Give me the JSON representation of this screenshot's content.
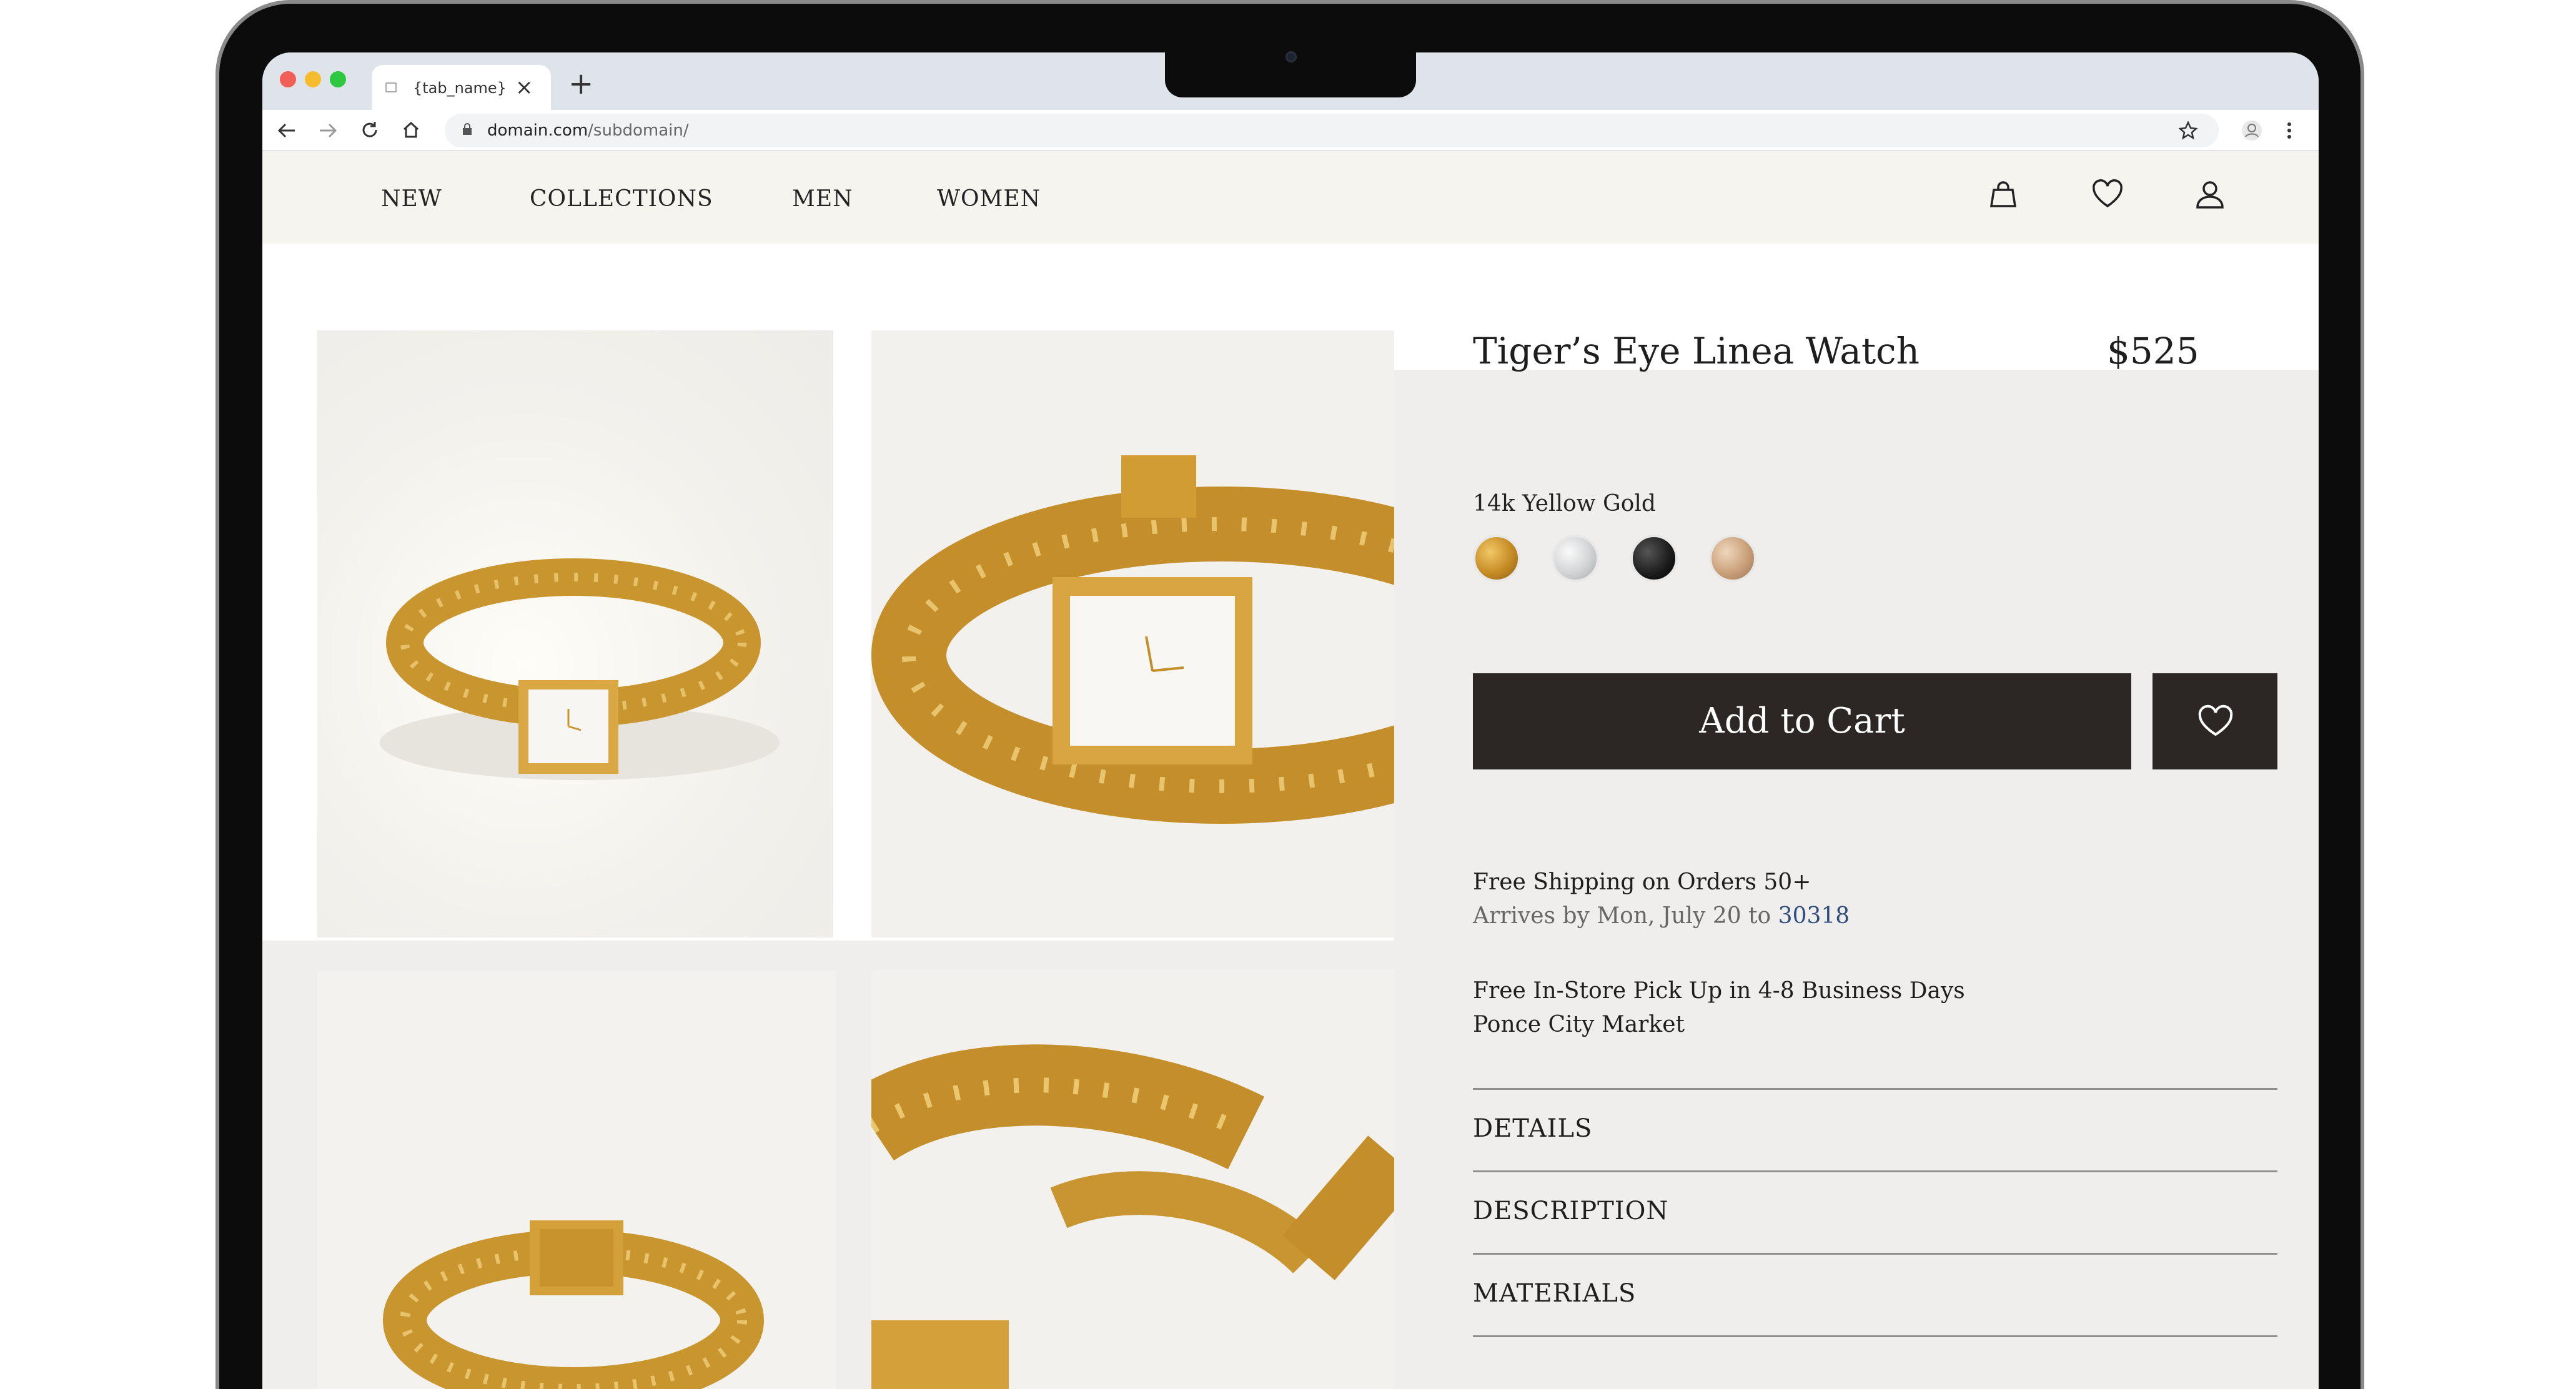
{
  "browser": {
    "tab_name": "{tab_name}",
    "tab_close": "×",
    "new_tab": "+",
    "url_domain": "domain.com",
    "url_path": "/subdomain/"
  },
  "nav": {
    "links": [
      "NEW",
      "COLLECTIONS",
      "MEN",
      "WOMEN"
    ],
    "icons": [
      "shopping-bag-icon",
      "heart-icon",
      "user-icon"
    ]
  },
  "product": {
    "title": "Tiger’s Eye Linea Watch",
    "price": "$525",
    "variant_label": "14k Yellow Gold",
    "swatches": [
      {
        "name": "yellow-gold",
        "color": "#c58b24"
      },
      {
        "name": "silver",
        "color": "#d2d3d5"
      },
      {
        "name": "black",
        "color": "#1a1a1a"
      },
      {
        "name": "rose-gold",
        "color": "#c9a07a"
      }
    ],
    "add_to_cart": "Add to Cart",
    "shipping_title": "Free Shipping on Orders 50+",
    "arrives_text": "Arrives by Mon, July 20 to ",
    "zip": "30318",
    "pickup_title": "Free In-Store Pick Up in 4-8 Business Days",
    "store": "Ponce City Market",
    "accordion": [
      "DETAILS",
      "DESCRIPTION",
      "MATERIALS"
    ]
  },
  "colors": {
    "button_dark": "#2c2724",
    "link_blue": "#2f4d7c",
    "nav_bg": "#f6f4ef",
    "panel_bg": "#efeeec"
  }
}
